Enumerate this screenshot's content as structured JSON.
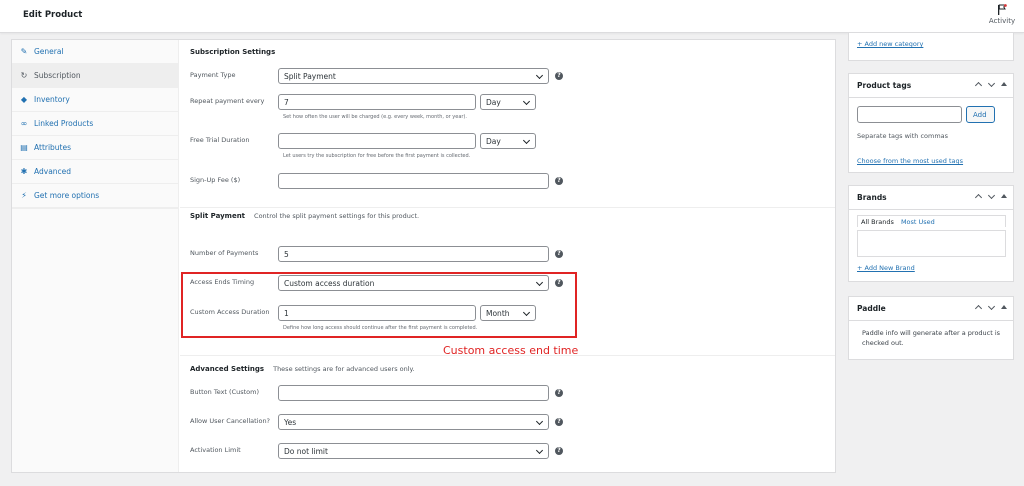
{
  "header": {
    "title": "Edit Product",
    "activity_label": "Activity"
  },
  "tabs": [
    {
      "label": "General",
      "icon": "wrench-icon"
    },
    {
      "label": "Subscription",
      "icon": "sync-icon"
    },
    {
      "label": "Inventory",
      "icon": "tag-icon"
    },
    {
      "label": "Linked Products",
      "icon": "link-icon"
    },
    {
      "label": "Attributes",
      "icon": "table-icon"
    },
    {
      "label": "Advanced",
      "icon": "gear-icon"
    },
    {
      "label": "Get more options",
      "icon": "plug-icon"
    }
  ],
  "subscription": {
    "title": "Subscription Settings",
    "payment_type": {
      "label": "Payment Type",
      "value": "Split Payment"
    },
    "repeat": {
      "label": "Repeat payment every",
      "value": "7",
      "unit": "Day",
      "hint": "Set how often the user will be charged (e.g. every week, month, or year)."
    },
    "trial": {
      "label": "Free Trial Duration",
      "value": "",
      "unit": "Day",
      "hint": "Let users try the subscription for free before the first payment is collected."
    },
    "signup": {
      "label": "Sign-Up Fee ($)",
      "value": ""
    }
  },
  "split": {
    "title": "Split Payment",
    "desc": "Control the split payment settings for this product.",
    "number": {
      "label": "Number of Payments",
      "value": "5"
    },
    "access_timing": {
      "label": "Access Ends Timing",
      "value": "Custom access duration"
    },
    "custom_duration": {
      "label": "Custom Access Duration",
      "value": "1",
      "unit": "Month",
      "hint": "Define how long access should continue after the first payment is completed."
    }
  },
  "annotation": "Custom access end time",
  "advanced": {
    "title": "Advanced Settings",
    "desc": "These settings are for advanced users only.",
    "button_text": {
      "label": "Button Text (Custom)",
      "value": ""
    },
    "cancel": {
      "label": "Allow User Cancellation?",
      "value": "Yes"
    },
    "limit": {
      "label": "Activation Limit",
      "value": "Do not limit"
    }
  },
  "sidebar": {
    "add_category": "+ Add new category",
    "tags": {
      "title": "Product tags",
      "add": "Add",
      "sep": "Separate tags with commas",
      "choose": "Choose from the most used tags"
    },
    "brands": {
      "title": "Brands",
      "tab_all": "All Brands",
      "tab_used": "Most Used",
      "add": "+ Add New Brand"
    },
    "paddle": {
      "title": "Paddle",
      "info": "Paddle info will generate after a product is checked out."
    }
  },
  "colors": {
    "link": "#2271b1",
    "annotation": "#e02424"
  }
}
